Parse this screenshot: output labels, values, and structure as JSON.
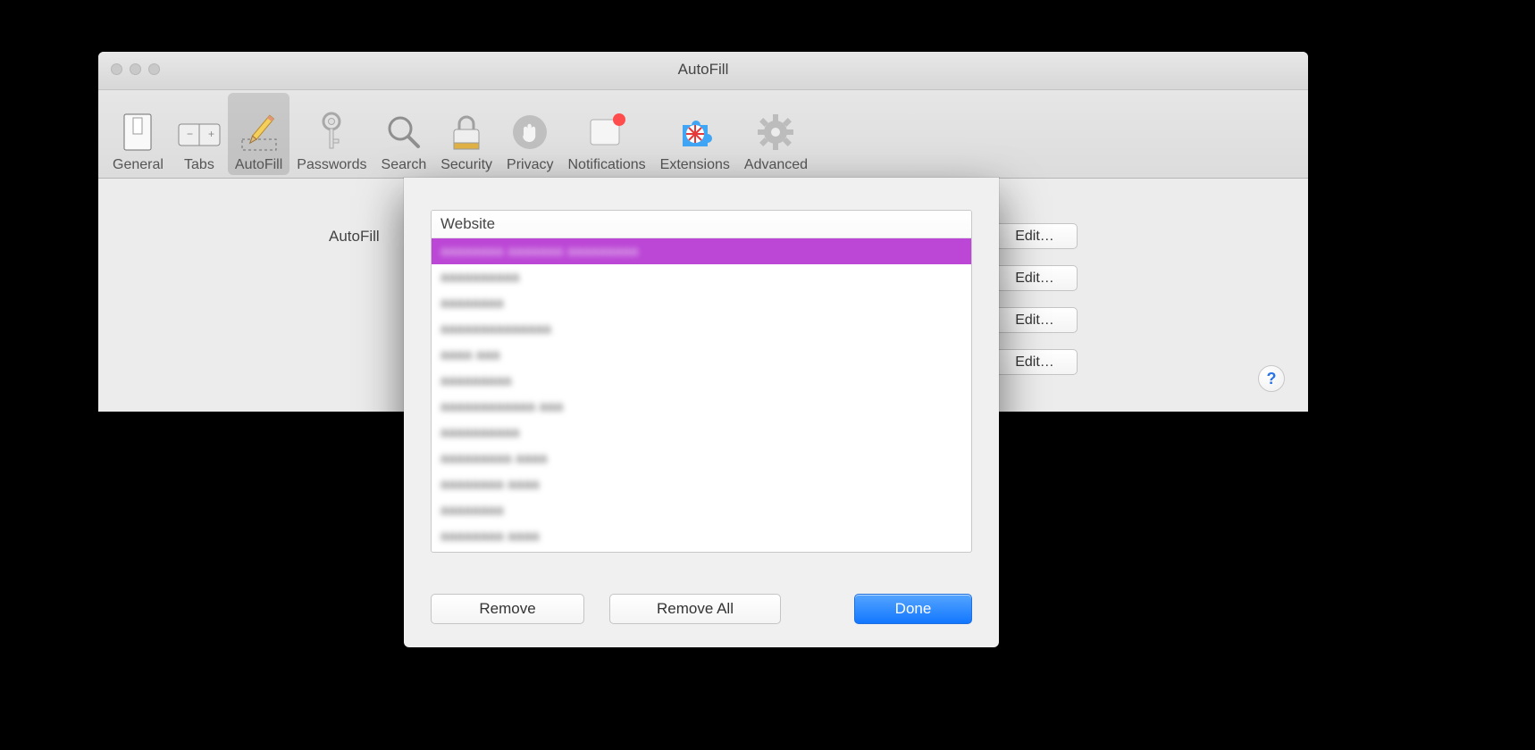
{
  "window": {
    "title": "AutoFill"
  },
  "toolbar": {
    "items": [
      {
        "id": "general",
        "label": "General"
      },
      {
        "id": "tabs",
        "label": "Tabs"
      },
      {
        "id": "autofill",
        "label": "AutoFill"
      },
      {
        "id": "passwords",
        "label": "Passwords"
      },
      {
        "id": "search",
        "label": "Search"
      },
      {
        "id": "security",
        "label": "Security"
      },
      {
        "id": "privacy",
        "label": "Privacy"
      },
      {
        "id": "notifications",
        "label": "Notifications"
      },
      {
        "id": "extensions",
        "label": "Extensions"
      },
      {
        "id": "advanced",
        "label": "Advanced"
      }
    ],
    "active": "autofill"
  },
  "content": {
    "heading": "AutoFill",
    "edit_label": "Edit…"
  },
  "sheet": {
    "column_header": "Website",
    "rows": [
      "aaaaaaaa aaaaaaa aaaaaaaaa",
      "aaaaaaaaaa",
      "aaaaaaaa",
      "aaaaaaaaaaaaaa",
      "aaaa aaa",
      "aaaaaaaaa",
      "aaaaaaaaaaaa aaa",
      "aaaaaaaaaa",
      "aaaaaaaaa aaaa",
      "aaaaaaaa aaaa",
      "aaaaaaaa",
      "aaaaaaaa aaaa"
    ],
    "selected_index": 0,
    "remove_label": "Remove",
    "remove_all_label": "Remove All",
    "done_label": "Done"
  },
  "help": "?"
}
